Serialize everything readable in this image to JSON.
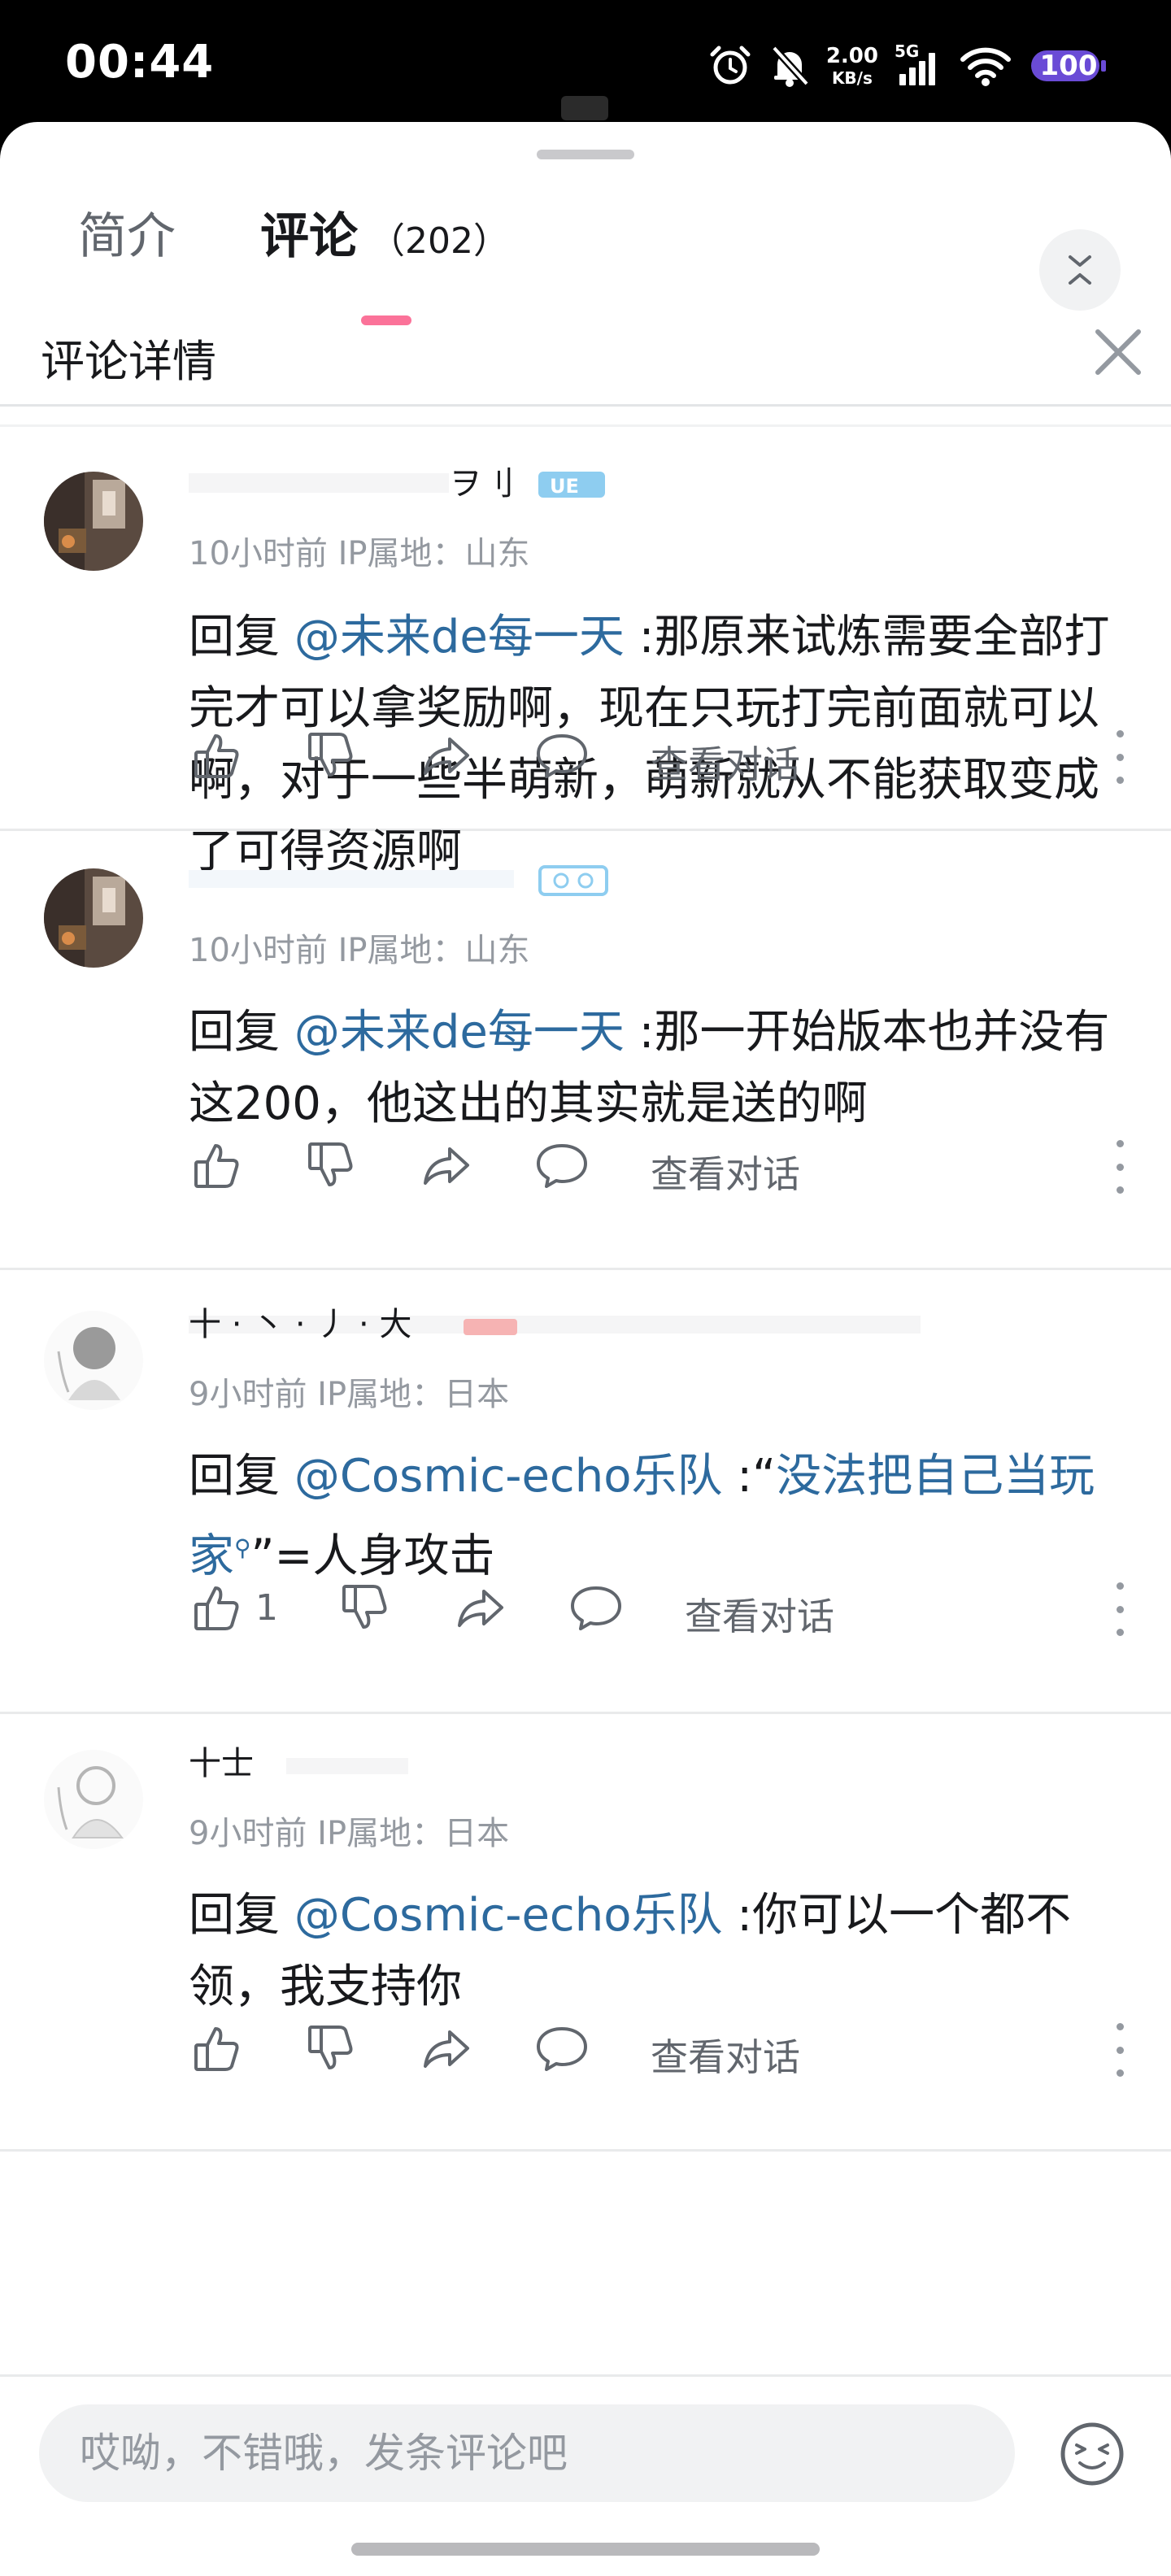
{
  "status_bar": {
    "time": "00:44",
    "net_speed_value": "2.00",
    "net_speed_unit": "KB/s",
    "network_type": "5G",
    "battery": "100"
  },
  "tabs": {
    "intro_label": "简介",
    "comments_label": "评论",
    "comments_count": "（202）"
  },
  "detail": {
    "title": "评论详情"
  },
  "comments": [
    {
      "meta": "10小时前 IP属地：山东",
      "reply_prefix": "回复 ",
      "mention": "@未来de每一天",
      "body": " :那原来试炼需要全部打完才可以拿奖励啊，现在只玩打完前面就可以啊，对于一些半萌新，萌新就从不能获取变成了可得资源啊",
      "like_count": "",
      "view_conversation": "查看对话"
    },
    {
      "meta": "10小时前 IP属地：山东",
      "reply_prefix": "回复 ",
      "mention": "@未来de每一天",
      "body": " :那一开始版本也并没有这200，他这出的其实就是送的啊",
      "like_count": "",
      "view_conversation": "查看对话"
    },
    {
      "meta": "9小时前 IP属地：日本",
      "reply_prefix": "回复 ",
      "mention": "@Cosmic-echo乐队",
      "body_pre": " :“",
      "keyword": "没法把自己当玩家",
      "body_post": "”=人身攻击",
      "like_count": "1",
      "view_conversation": "查看对话"
    },
    {
      "meta": "9小时前 IP属地：日本",
      "reply_prefix": "回复 ",
      "mention": "@Cosmic-echo乐队",
      "body": " :你可以一个都不领，我支持你",
      "like_count": "",
      "view_conversation": "查看对话"
    }
  ],
  "composer": {
    "placeholder": "哎呦，不错哦，发条评论吧"
  },
  "colors": {
    "accent_pink": "#fb7299",
    "link_blue": "#2d6a9e",
    "meta_gray": "#9499a0"
  },
  "icons": [
    "alarm-icon",
    "bell-off-icon",
    "signal-icon",
    "wifi-icon",
    "battery-icon",
    "collapse-icon",
    "close-icon",
    "like-icon",
    "dislike-icon",
    "share-icon",
    "reply-icon",
    "more-icon",
    "emoji-icon"
  ]
}
